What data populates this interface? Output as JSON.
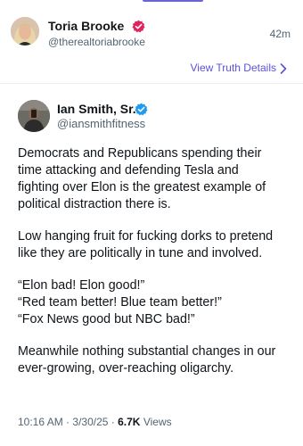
{
  "post": {
    "author_name": "Toria Brooke",
    "author_handle": "@therealtoriabrooke",
    "time_ago": "42m",
    "view_details_label": "View Truth Details"
  },
  "quoted_tweet": {
    "author_name": "Ian Smith, Sr.",
    "author_handle": "@iansmithfitness",
    "paragraphs": [
      [
        "Democrats and Republicans spending their",
        "time attacking and defending Tesla and",
        "fighting over Elon is the greatest example of",
        "political distraction there is."
      ],
      [
        "Low hanging fruit for fucking dorks to pretend",
        "like they are politically in tune and involved."
      ],
      [
        "“Elon bad! Elon good!”",
        "“Red team better! Blue team better!”",
        "“Fox News good but NBC bad!”"
      ],
      [
        "Meanwhile nothing substantial changes in our",
        "ever-growing, over-reaching oligarchy."
      ]
    ],
    "time": "10:16 AM",
    "separator": "·",
    "date": "3/30/25",
    "views_count": "6.7K",
    "views_label": "Views"
  },
  "colors": {
    "accent": "#5c52d6",
    "verified_blue": "#1d9bf0",
    "badge_red": "#e0245e",
    "muted": "#536471"
  },
  "icons": {
    "post_verified": "verified-check-icon",
    "quote_verified": "verified-check-icon",
    "details": "chevron-right-icon"
  }
}
